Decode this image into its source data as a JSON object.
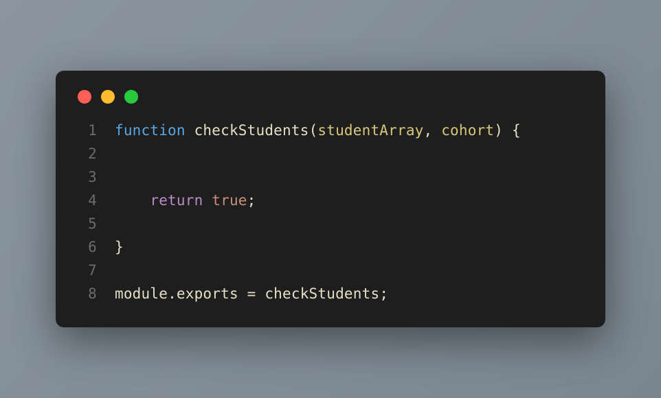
{
  "window_controls": {
    "red": "close-icon",
    "yellow": "minimize-icon",
    "green": "zoom-icon"
  },
  "code": {
    "lines": [
      {
        "n": "1",
        "tokens": [
          {
            "t": "function ",
            "c": "tok-keyword"
          },
          {
            "t": "checkStudents",
            "c": "tok-funcname"
          },
          {
            "t": "(",
            "c": "tok-punct"
          },
          {
            "t": "studentArray",
            "c": "tok-param"
          },
          {
            "t": ", ",
            "c": "tok-punct"
          },
          {
            "t": "cohort",
            "c": "tok-param"
          },
          {
            "t": ") {",
            "c": "tok-punct"
          }
        ]
      },
      {
        "n": "2",
        "tokens": []
      },
      {
        "n": "3",
        "tokens": []
      },
      {
        "n": "4",
        "tokens": [
          {
            "t": "    ",
            "c": ""
          },
          {
            "t": "return ",
            "c": "tok-return"
          },
          {
            "t": "true",
            "c": "tok-bool"
          },
          {
            "t": ";",
            "c": "tok-punct"
          }
        ]
      },
      {
        "n": "5",
        "tokens": []
      },
      {
        "n": "6",
        "tokens": [
          {
            "t": "}",
            "c": "tok-punct"
          }
        ]
      },
      {
        "n": "7",
        "tokens": []
      },
      {
        "n": "8",
        "tokens": [
          {
            "t": "module",
            "c": "tok-ident"
          },
          {
            "t": ".",
            "c": "tok-punct"
          },
          {
            "t": "exports",
            "c": "tok-ident"
          },
          {
            "t": " = ",
            "c": "tok-op"
          },
          {
            "t": "checkStudents",
            "c": "tok-ident"
          },
          {
            "t": ";",
            "c": "tok-punct"
          }
        ]
      }
    ]
  }
}
